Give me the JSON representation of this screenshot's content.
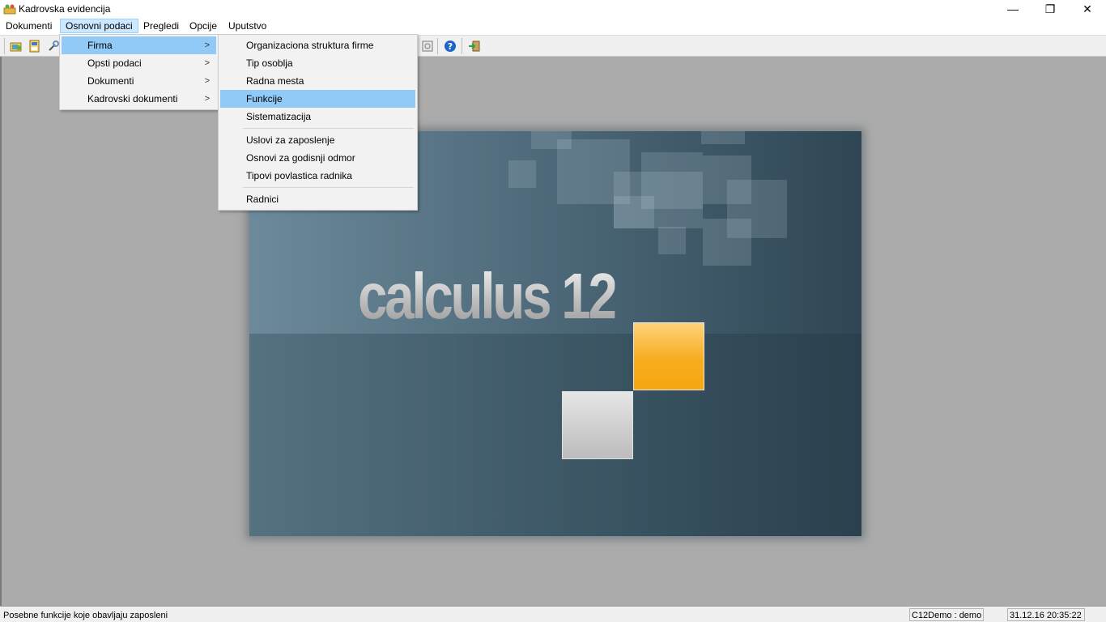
{
  "window": {
    "title": "Kadrovska evidencija",
    "minimize": "—",
    "maximize": "❐",
    "close": "✕"
  },
  "menubar": [
    "Dokumenti",
    "Osnovni podaci",
    "Pregledi",
    "Opcije",
    "Uputstvo"
  ],
  "toolbar_icons": [
    "folder-open-icon",
    "save-icon",
    "tools-icon",
    "window-icon",
    "help-icon",
    "exit-icon"
  ],
  "osnovni_menu": {
    "items": [
      {
        "label": "Firma",
        "arrow": ">",
        "highlighted": true
      },
      {
        "label": "Opsti podaci",
        "arrow": ">"
      },
      {
        "label": "Dokumenti",
        "arrow": ">"
      },
      {
        "label": "Kadrovski dokumenti",
        "arrow": ">"
      }
    ]
  },
  "firma_menu": {
    "group1": [
      "Organizaciona struktura firme",
      "Tip osoblja",
      "Radna mesta",
      "Funkcije",
      "Sistematizacija"
    ],
    "group2": [
      "Uslovi za zaposlenje",
      "Osnovi za godisnji odmor",
      "Tipovi povlastica radnika"
    ],
    "group3": [
      "Radnici"
    ],
    "highlighted": "Funkcije"
  },
  "splash": {
    "logo_text": "calculus 12"
  },
  "status": {
    "message": "Posebne funkcije koje obavljaju zaposleni",
    "user": "C12Demo : demo",
    "datetime": "31.12.16 20:35:22"
  },
  "colors": {
    "highlight": "#91c9f7",
    "menu_active": "#cce8ff",
    "orange": "#f4a710"
  }
}
